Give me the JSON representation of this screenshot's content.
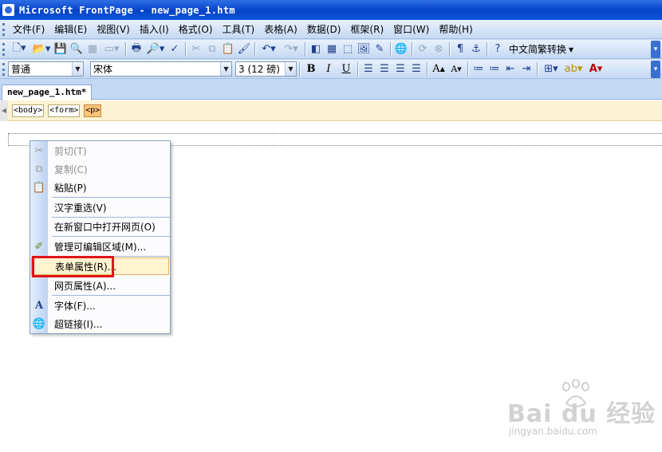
{
  "window": {
    "title": "Microsoft FrontPage - new_page_1.htm"
  },
  "menu": [
    "文件(F)",
    "编辑(E)",
    "视图(V)",
    "插入(I)",
    "格式(O)",
    "工具(T)",
    "表格(A)",
    "数据(D)",
    "框架(R)",
    "窗口(W)",
    "帮助(H)"
  ],
  "toolbar": {
    "translate_label": "中文简繁转换"
  },
  "format": {
    "style": "普通",
    "font": "宋体",
    "size": "3 (12 磅)"
  },
  "tab": {
    "label": "new_page_1.htm*"
  },
  "quick_tags": [
    "<body>",
    "<form>",
    "<p>"
  ],
  "context_menu": {
    "cut": "剪切(T)",
    "copy": "复制(C)",
    "paste": "粘贴(P)",
    "reconvert": "汉字重选(V)",
    "open_new_window": "在新窗口中打开网页(O)",
    "manage_editable": "管理可编辑区域(M)...",
    "form_props": "表单属性(R)...",
    "page_props": "网页属性(A)...",
    "font": "字体(F)...",
    "hyperlink": "超链接(I)..."
  },
  "watermark": {
    "brand": "Bai du 经验",
    "url": "jingyan.baidu.com"
  }
}
